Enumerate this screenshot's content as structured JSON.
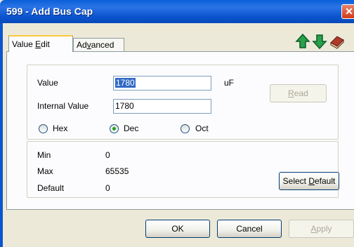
{
  "window": {
    "title": "599 -  Add Bus Cap",
    "close_glyph": "✕"
  },
  "tabs": {
    "value_edit": {
      "pre": "Value ",
      "key": "E",
      "post": "dit"
    },
    "advanced": {
      "pre": "Ad",
      "key": "v",
      "post": "anced"
    }
  },
  "icons": [
    "up-arrow-icon",
    "down-arrow-icon",
    "book-icon"
  ],
  "fields": {
    "value_label": "Value",
    "value": "1780",
    "unit": "uF",
    "internal_label": "Internal Value",
    "internal_value": "1780"
  },
  "radix": {
    "options": [
      "Hex",
      "Dec",
      "Oct"
    ],
    "selected": "Dec"
  },
  "buttons": {
    "read": {
      "key": "R",
      "post": "ead"
    },
    "select_default": {
      "pre": "Select ",
      "key": "D",
      "post": "efault"
    },
    "ok": "OK",
    "cancel": "Cancel",
    "apply": {
      "key": "A",
      "post": "pply"
    }
  },
  "limits": {
    "min_label": "Min",
    "min": "0",
    "max_label": "Max",
    "max": "65535",
    "default_label": "Default",
    "default": "0"
  },
  "colors": {
    "title_bar": "#0b55d0",
    "tab_highlight": "#ffc83c",
    "arrow_icon": "#2aa048",
    "book_icon": "#b23a2c",
    "selection": "#316ac5"
  }
}
